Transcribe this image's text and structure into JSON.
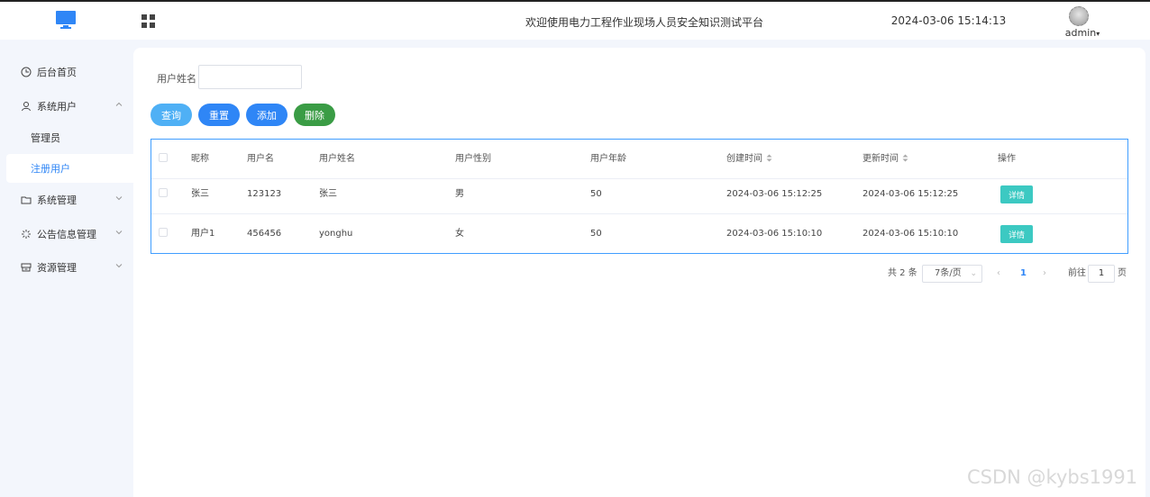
{
  "header": {
    "title": "欢迎使用电力工程作业现场人员安全知识测试平台",
    "datetime": "2024-03-06 15:14:13",
    "username": "admin",
    "dropdown_glyph": "▾"
  },
  "sidebar": {
    "items": [
      {
        "label": "后台首页",
        "icon": "clock-icon"
      },
      {
        "label": "系统用户",
        "icon": "user-icon",
        "expanded": true,
        "children": [
          {
            "label": "管理员"
          },
          {
            "label": "注册用户",
            "active": true
          }
        ]
      },
      {
        "label": "系统管理",
        "icon": "folder-icon"
      },
      {
        "label": "公告信息管理",
        "icon": "loading-icon"
      },
      {
        "label": "资源管理",
        "icon": "box-icon"
      }
    ]
  },
  "search": {
    "label": "用户姓名",
    "value": "",
    "placeholder": ""
  },
  "actions": {
    "query": "查询",
    "reset": "重置",
    "add": "添加",
    "delete": "删除"
  },
  "table": {
    "headers": [
      "昵称",
      "用户名",
      "用户姓名",
      "用户性别",
      "用户年龄",
      "创建时间",
      "更新时间",
      "操作"
    ],
    "rows": [
      {
        "nickname": "张三",
        "username": "123123",
        "realname": "张三",
        "gender": "男",
        "age": "50",
        "created": "2024-03-06 15:12:25",
        "updated": "2024-03-06 15:12:25",
        "action": "详情"
      },
      {
        "nickname": "用户1",
        "username": "456456",
        "realname": "yonghu",
        "gender": "女",
        "age": "50",
        "created": "2024-03-06 15:10:10",
        "updated": "2024-03-06 15:10:10",
        "action": "详情"
      }
    ]
  },
  "pagination": {
    "total": "共 2 条",
    "page_size": "7条/页",
    "current_page": "1",
    "goto_label": "前往",
    "goto_value": "1",
    "page_unit": "页",
    "prev_glyph": "‹",
    "next_glyph": "›"
  },
  "watermark": "CSDN @kybs1991",
  "colors": {
    "brand": "#2f86f6",
    "query": "#4fb0f5",
    "reset": "#2f86f6",
    "add": "#2f86f6",
    "delete": "#3a9c45",
    "detail": "#3cc9c2"
  }
}
